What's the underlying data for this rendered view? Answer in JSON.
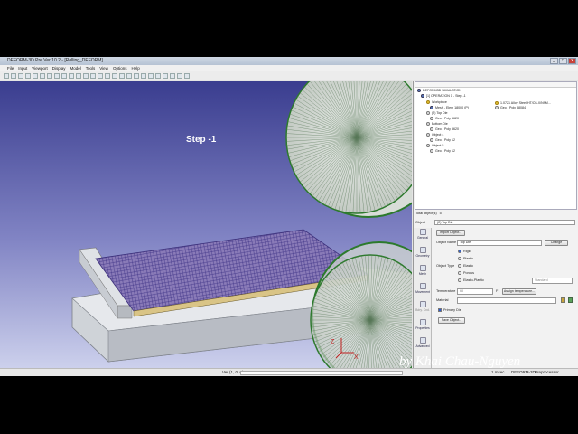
{
  "window": {
    "title": "DEFORM-3D Pre Ver 10.2 - [Rolling_DEFORM]",
    "controls": [
      "_",
      "□",
      "x"
    ]
  },
  "menu": [
    "File",
    "Input",
    "Viewport",
    "Display",
    "Model",
    "Tools",
    "View",
    "Options",
    "Help"
  ],
  "viewport": {
    "step_label": "Step -1",
    "axes": {
      "x": "X",
      "z": "Z"
    }
  },
  "tree": {
    "items": [
      {
        "text": "DEFORM3D SIMULATION"
      },
      {
        "text": "[1] OPERATION 1 - Step -1"
      },
      {
        "text": "Workpiece"
      },
      {
        "text": "Mesh - Elem 18000 (P)"
      },
      {
        "text": "1.0721 Alloy Steel(HT/O3-X/N9M..."
      },
      {
        "text": "Geo - Poly 38084"
      },
      {
        "text": "(2) Top Die"
      },
      {
        "text": "Geo - Poly 5620"
      },
      {
        "text": "Bottom Die"
      },
      {
        "text": "Geo - Poly 5620"
      },
      {
        "text": "Object 4"
      },
      {
        "text": "Geo - Poly 12"
      },
      {
        "text": "Object 5"
      },
      {
        "text": "Geo - Poly 12"
      }
    ]
  },
  "totals": {
    "label": "Total object(s)",
    "count": "5"
  },
  "object_selector": {
    "label": "Object",
    "value": "(2) Top Die"
  },
  "side_tabs": [
    "General",
    "Geometry",
    "Mesh",
    "Movement",
    "Bdry. Cnd.",
    "Properties",
    "Advanced"
  ],
  "props": {
    "import_button": "Import Object...",
    "object_name_label": "Object Name",
    "object_name_value": "Top Die",
    "change_button": "Change",
    "object_type_label": "Object Type",
    "types": [
      {
        "label": "Rigid",
        "selected": true
      },
      {
        "label": "Plastic",
        "selected": false
      },
      {
        "label": "Elastic",
        "selected": false
      },
      {
        "label": "Porous",
        "selected": false
      },
      {
        "label": "Elasto-Plastic",
        "selected": false
      }
    ],
    "standard": "Standard",
    "temperature_label": "Temperature",
    "temperature_value": "68",
    "temperature_unit": "F",
    "assign_temp_button": "Assign temperature...",
    "material_label": "Material",
    "primary_die_label": "Primary Die",
    "save_button": "Save Object..."
  },
  "status": {
    "coords": "Ver (1, 0, 0)",
    "time": "1 msec",
    "version": "DEFORM-3D",
    "processor": "Preprocessor"
  },
  "watermark": "by Khai Chau-Nguyen",
  "colors": {
    "accent": "#2a5bd7",
    "roller_green": "#2c7a2c",
    "viewport_top": "#3a3d8f"
  }
}
